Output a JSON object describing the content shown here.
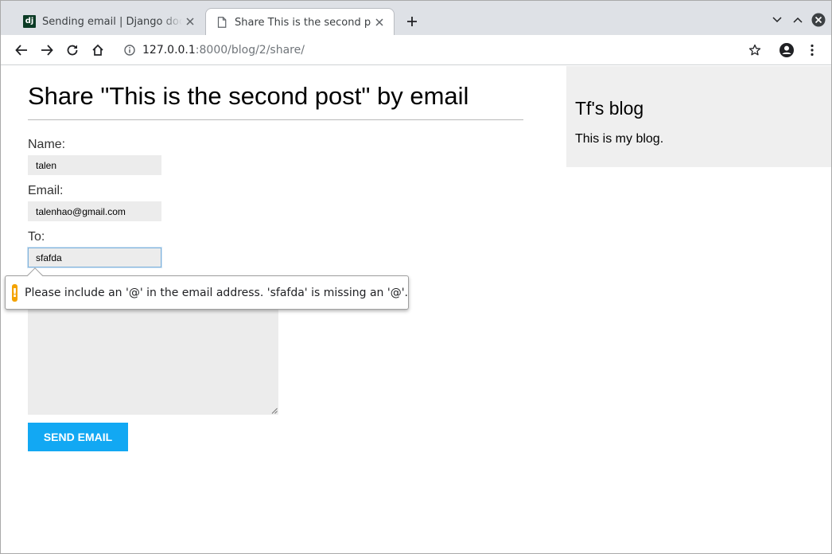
{
  "browser": {
    "tabs": [
      {
        "title": "Sending email | Django documentation",
        "favicon": "dj"
      },
      {
        "title": "Share This is the second post",
        "favicon": "page-icon"
      }
    ],
    "new_tab_icon": "plus-icon",
    "url_host": "127.0.0.1",
    "url_rest": ":8000/blog/2/share/"
  },
  "page": {
    "title": "Share \"This is the second post\" by email",
    "form": {
      "name_label": "Name:",
      "name_value": "talen",
      "email_label": "Email:",
      "email_value": "talenhao@gmail.com",
      "to_label": "To:",
      "to_value": "sfafda",
      "submit_label": "SEND EMAIL"
    },
    "validation": {
      "message": "Please include an '@' in the email address. 'sfafda' is missing an '@'.",
      "icon": "warning-icon",
      "color": "#f4a300"
    }
  },
  "sidebar": {
    "title": "Tf's blog",
    "description": "This is my blog."
  },
  "colors": {
    "accent": "#12a8f3",
    "sidebar_bg": "#efefef",
    "field_bg": "#ececec"
  }
}
